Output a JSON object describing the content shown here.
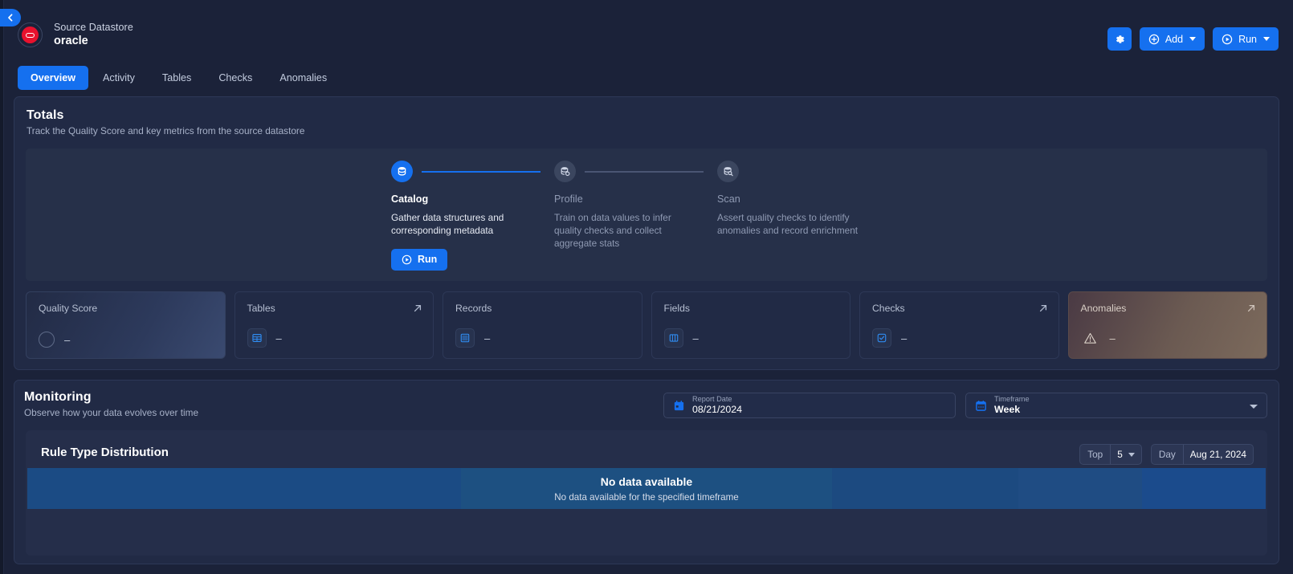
{
  "app": {
    "collapse_icon": "chevron-left-icon"
  },
  "header": {
    "datastore_label": "Source Datastore",
    "datastore_name": "oracle",
    "avatar_icon": "oracle-logo-icon",
    "actions": {
      "settings_icon": "gear-icon",
      "add_label": "Add",
      "add_icon": "plus-circle-icon",
      "run_label": "Run",
      "run_icon": "play-circle-icon"
    }
  },
  "tabs": [
    {
      "label": "Overview",
      "active": true
    },
    {
      "label": "Activity",
      "active": false
    },
    {
      "label": "Tables",
      "active": false
    },
    {
      "label": "Checks",
      "active": false
    },
    {
      "label": "Anomalies",
      "active": false
    }
  ],
  "totals": {
    "title": "Totals",
    "subtitle": "Track the Quality Score and key metrics from the source datastore",
    "steps": [
      {
        "name": "Catalog",
        "description": "Gather data structures and corresponding metadata",
        "icon": "database-icon",
        "active": true,
        "run_label": "Run"
      },
      {
        "name": "Profile",
        "description": "Train on data values to infer quality checks and collect aggregate stats",
        "icon": "database-gear-icon",
        "active": false
      },
      {
        "name": "Scan",
        "description": "Assert quality checks to identify anomalies and record enrichment",
        "icon": "database-search-icon",
        "active": false
      }
    ],
    "metrics": [
      {
        "label": "Quality Score",
        "value": "–",
        "icon": "score-ring-icon",
        "has_arrow": false,
        "style": "quality"
      },
      {
        "label": "Tables",
        "value": "–",
        "icon": "table-icon",
        "has_arrow": true,
        "style": "default"
      },
      {
        "label": "Records",
        "value": "–",
        "icon": "records-icon",
        "has_arrow": false,
        "style": "default"
      },
      {
        "label": "Fields",
        "value": "–",
        "icon": "columns-icon",
        "has_arrow": false,
        "style": "default"
      },
      {
        "label": "Checks",
        "value": "–",
        "icon": "check-square-icon",
        "has_arrow": true,
        "style": "default"
      },
      {
        "label": "Anomalies",
        "value": "–",
        "icon": "warning-triangle-icon",
        "has_arrow": true,
        "style": "anomalies"
      }
    ]
  },
  "monitoring": {
    "title": "Monitoring",
    "subtitle": "Observe how your data evolves over time",
    "report_date": {
      "label": "Report Date",
      "value": "08/21/2024",
      "icon": "calendar-icon"
    },
    "timeframe": {
      "label": "Timeframe",
      "value": "Week",
      "icon": "calendar-range-icon"
    }
  },
  "rule_type_distribution": {
    "title": "Rule Type Distribution",
    "top_selector": {
      "label": "Top",
      "value": "5"
    },
    "day_selector": {
      "label": "Day",
      "value": "Aug 21, 2024"
    },
    "empty_title": "No data available",
    "empty_subtitle": "No data available for the specified timeframe"
  },
  "chart_data": {
    "type": "bar",
    "title": "Rule Type Distribution",
    "categories": [],
    "values": [],
    "series": [],
    "xlabel": "",
    "ylabel": "",
    "grid": false,
    "legend": "none",
    "empty_state": "No data available for the specified timeframe",
    "skeleton_segments": [
      {
        "width_pct": 35.0,
        "color": "#1b4b84"
      },
      {
        "width_pct": 30.0,
        "color": "#1d5081"
      },
      {
        "width_pct": 15.0,
        "color": "#1c4a80"
      },
      {
        "width_pct": 10.0,
        "color": "#1f4c83"
      },
      {
        "width_pct": 10.0,
        "color": "#1b4b8c"
      }
    ]
  },
  "colors": {
    "accent": "#1570ef",
    "panel": "#212a45",
    "page_bg": "#1b2239",
    "oracle_red": "#e8112d",
    "muted_text": "#8f9ab3"
  }
}
